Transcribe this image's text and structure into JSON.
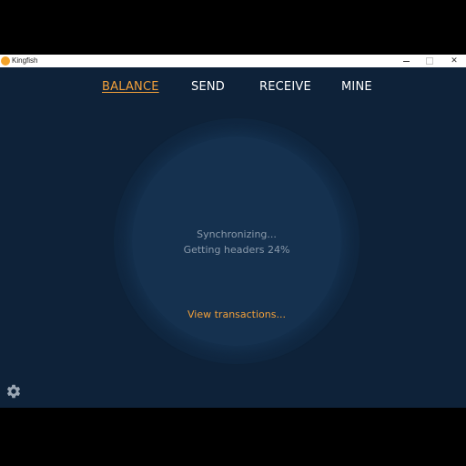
{
  "window": {
    "title": "Kingfish",
    "controls": {
      "minimize": "minimize",
      "maximize": "maximize",
      "close": "✕"
    }
  },
  "nav": {
    "tabs": [
      {
        "label": "BALANCE",
        "active": true
      },
      {
        "label": "SEND",
        "active": false
      },
      {
        "label": "RECEIVE",
        "active": false
      },
      {
        "label": "MINE",
        "active": false
      }
    ]
  },
  "balance": {
    "status": "Synchronizing...",
    "progress_text": "Getting headers 24%",
    "progress_percent": 24,
    "view_transactions": "View transactions..."
  },
  "icons": {
    "app": "kingfish-logo-icon",
    "settings": "gear-icon"
  },
  "colors": {
    "background": "#0e2239",
    "accent": "#f2a03a",
    "circle": "#15314f",
    "muted_text": "#8a9aab"
  }
}
